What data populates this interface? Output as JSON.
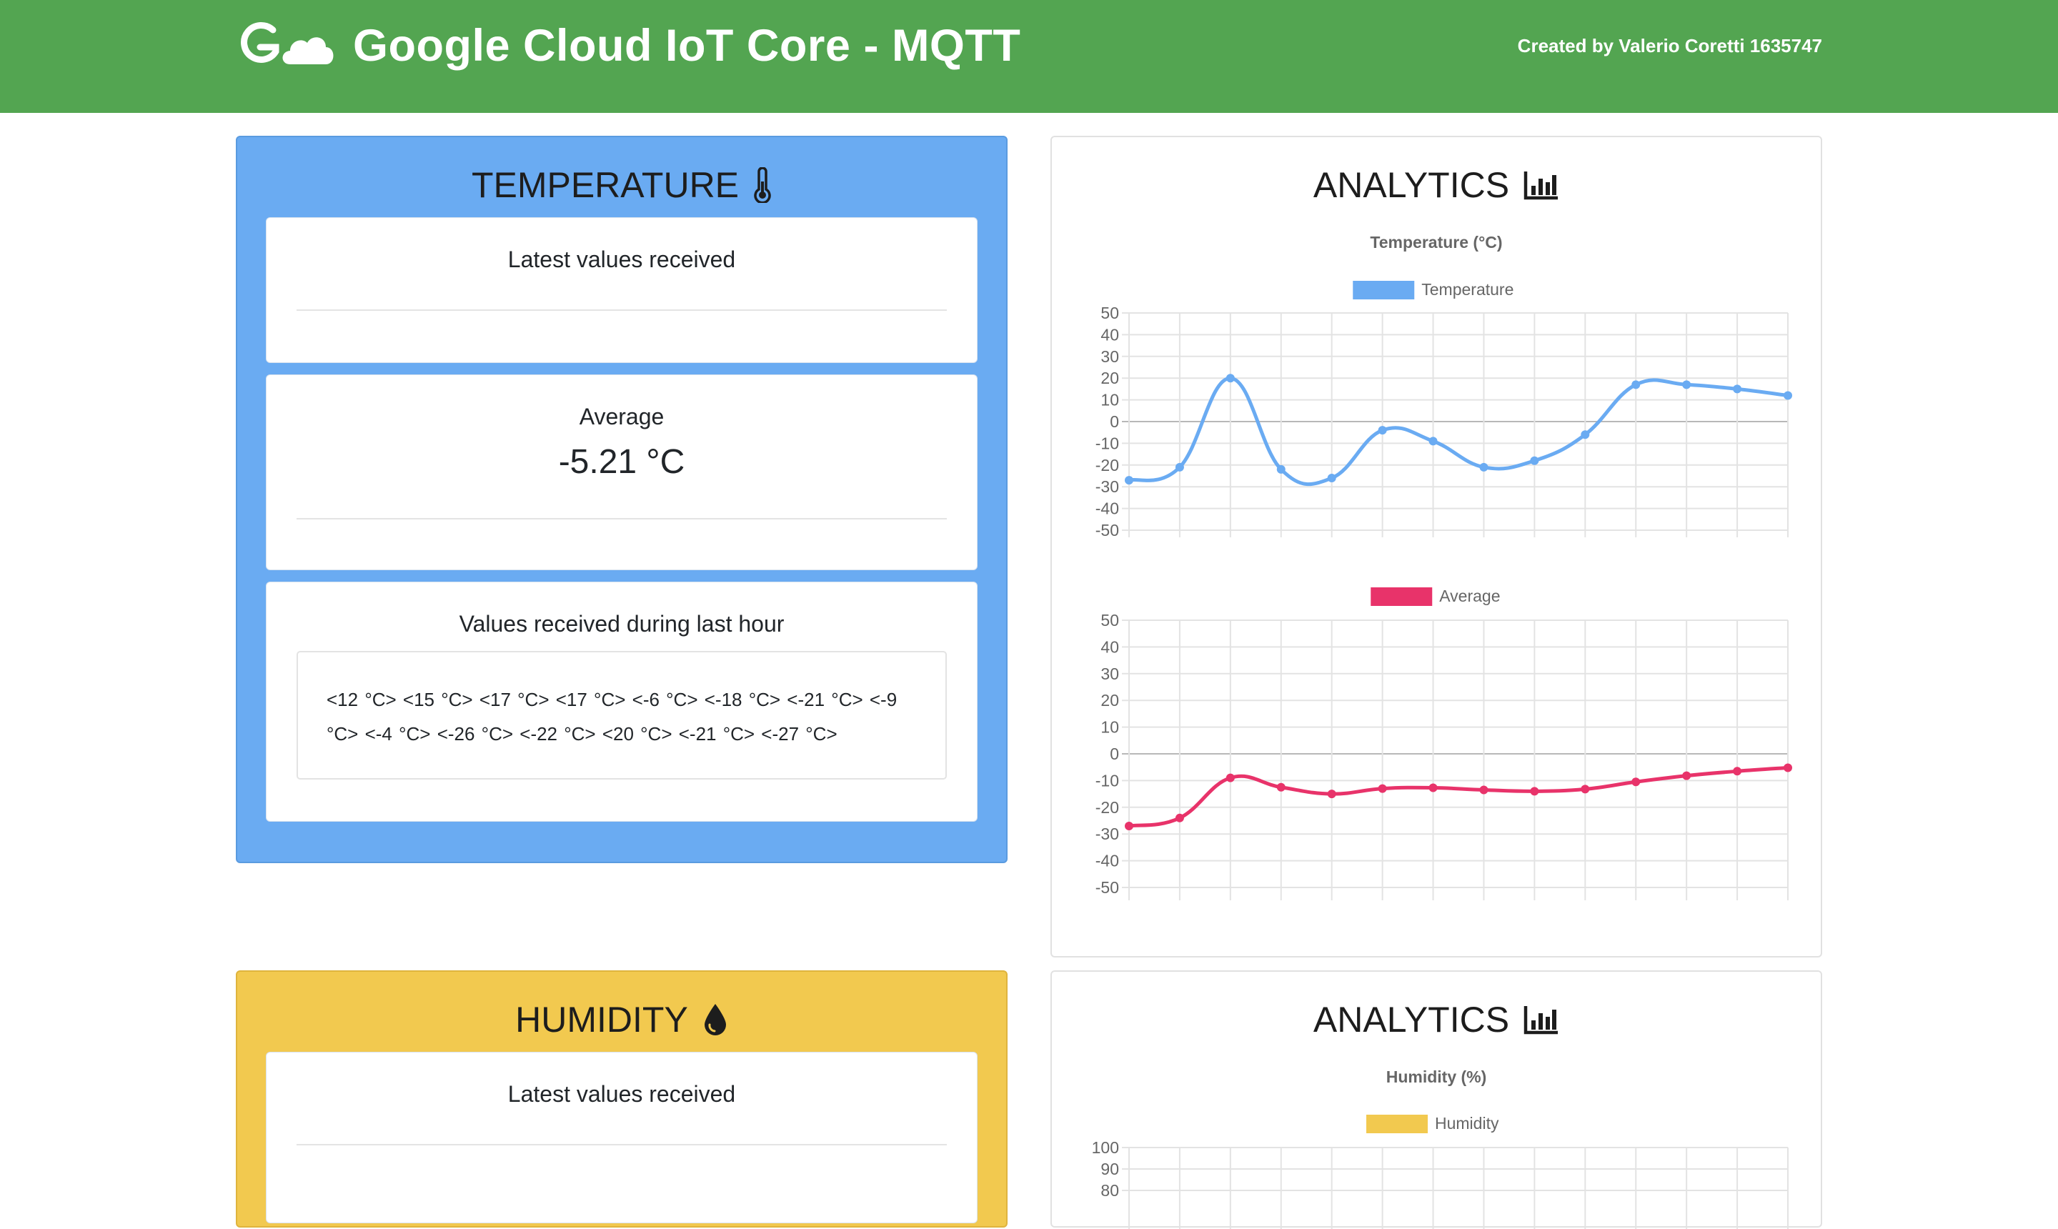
{
  "header": {
    "title": "Google Cloud IoT Core - MQTT",
    "credit": "Created by Valerio Coretti 1635747",
    "background": "#53a551"
  },
  "temperature_panel": {
    "title": "TEMPERATURE",
    "icon": "thermometer-icon",
    "color": "#6aabf2",
    "latest": {
      "label": "Latest values received"
    },
    "average": {
      "label": "Average",
      "value": "-5.21 °C"
    },
    "history": {
      "label": "Values received during last hour",
      "text": "<12 °C> <15 °C> <17 °C> <17 °C> <-6 °C> <-18 °C> <-21 °C> <-9 °C> <-4 °C> <-26 °C> <-22 °C> <20 °C> <-21 °C> <-27 °C>"
    }
  },
  "humidity_panel": {
    "title": "HUMIDITY",
    "icon": "droplet-icon",
    "color": "#f2c94f",
    "latest": {
      "label": "Latest values received"
    }
  },
  "analytics_temperature": {
    "title": "ANALYTICS",
    "icon": "bar-chart-icon"
  },
  "analytics_humidity": {
    "title": "ANALYTICS",
    "icon": "bar-chart-icon"
  },
  "chart_data": [
    {
      "type": "line",
      "title": "Temperature (°C)",
      "legend_position": "top",
      "grid": true,
      "ylim": [
        -50,
        50
      ],
      "yticks": [
        50,
        40,
        30,
        20,
        10,
        0,
        -10,
        -20,
        -30,
        -40,
        -50
      ],
      "series": [
        {
          "name": "Temperature",
          "color": "#6aabf2",
          "values": [
            -27,
            -21,
            20,
            -22,
            -26,
            -4,
            -9,
            -21,
            -18,
            -6,
            17,
            17,
            15,
            12
          ]
        }
      ]
    },
    {
      "type": "line",
      "title": "",
      "legend_position": "top",
      "grid": true,
      "ylim": [
        -50,
        50
      ],
      "yticks": [
        50,
        40,
        30,
        20,
        10,
        0,
        -10,
        -20,
        -30,
        -40,
        -50
      ],
      "series": [
        {
          "name": "Average",
          "color": "#e8336a",
          "values": [
            -27,
            -24,
            -9,
            -12.5,
            -15,
            -13,
            -12.7,
            -13.5,
            -14,
            -13.2,
            -10.5,
            -8.2,
            -6.5,
            -5.2
          ]
        }
      ]
    },
    {
      "type": "line",
      "title": "Humidity (%)",
      "legend_position": "top",
      "grid": true,
      "ylim": [
        0,
        100
      ],
      "yticks": [
        100,
        90,
        80
      ],
      "series": [
        {
          "name": "Humidity",
          "color": "#f2c94f",
          "values": []
        }
      ]
    }
  ]
}
